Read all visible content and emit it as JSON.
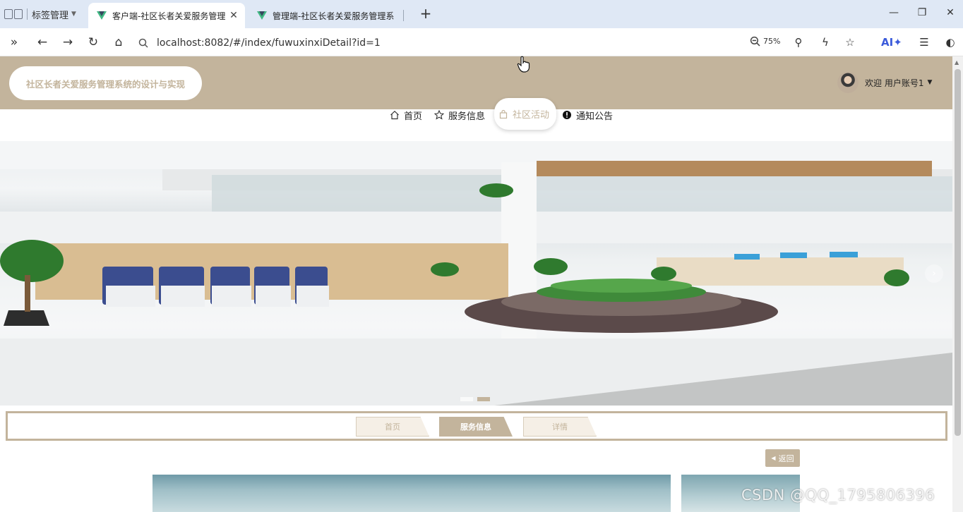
{
  "browser": {
    "tab_group_label": "标签管理",
    "tabs": [
      {
        "title": "客户端-社区长者关爱服务管理"
      },
      {
        "title": "管理端-社区长者关爱服务管理系"
      }
    ],
    "url": "localhost:8082/#/index/fuwuxinxiDetail?id=1",
    "zoom": "75%",
    "ai_label": "AI"
  },
  "site": {
    "title": "社区长者关爱服务管理系统的设计与实现",
    "user_greeting": "欢迎 用户账号1",
    "nav": [
      {
        "label": "首页",
        "icon": "home-icon"
      },
      {
        "label": "服务信息",
        "icon": "star-icon"
      },
      {
        "label": "社区活动",
        "icon": "bag-icon"
      },
      {
        "label": "通知公告",
        "icon": "alert-icon"
      }
    ]
  },
  "breadcrumb": [
    "首页",
    "服务信息",
    "详情"
  ],
  "back_label": "返回",
  "watermark": "CSDN @QQ_1795806396",
  "colors": {
    "theme": "#c3b49c",
    "tabbar": "#dfe8f5"
  }
}
